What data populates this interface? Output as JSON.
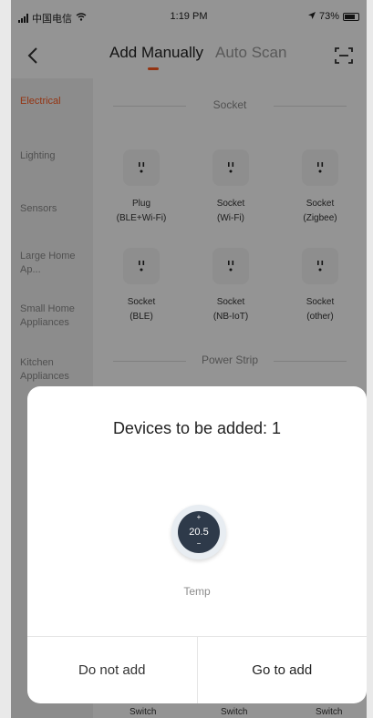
{
  "status_bar": {
    "carrier": "中国电信",
    "time": "1:19 PM",
    "battery": "73%"
  },
  "header": {
    "tabs": [
      {
        "label": "Add Manually",
        "active": true
      },
      {
        "label": "Auto Scan",
        "active": false
      }
    ],
    "accent_color": "#ff5a1f"
  },
  "sidebar": {
    "items": [
      {
        "label": "Electrical",
        "active": true
      },
      {
        "label": "Lighting"
      },
      {
        "label": "Sensors"
      },
      {
        "label": "Large Home Ap..."
      },
      {
        "label": "Small Home Appliances"
      },
      {
        "label": "Kitchen Appliances"
      }
    ]
  },
  "content": {
    "sections": [
      {
        "title": "Socket"
      },
      {
        "title": "Power Strip"
      }
    ],
    "devices": [
      {
        "line1": "Plug",
        "line2": "(BLE+Wi-Fi)"
      },
      {
        "line1": "Socket",
        "line2": "(Wi-Fi)"
      },
      {
        "line1": "Socket",
        "line2": "(Zigbee)"
      },
      {
        "line1": "Socket",
        "line2": "(BLE)"
      },
      {
        "line1": "Socket",
        "line2": "(NB-IoT)"
      },
      {
        "line1": "Socket",
        "line2": "(other)"
      }
    ],
    "bottom_labels": [
      "Switch",
      "Switch",
      "Switch"
    ]
  },
  "modal": {
    "title": "Devices to be added: 1",
    "device": {
      "plus": "+",
      "value": "20.5",
      "minus": "−",
      "label": "Temp"
    },
    "buttons": {
      "cancel": "Do not add",
      "confirm": "Go to add"
    }
  }
}
